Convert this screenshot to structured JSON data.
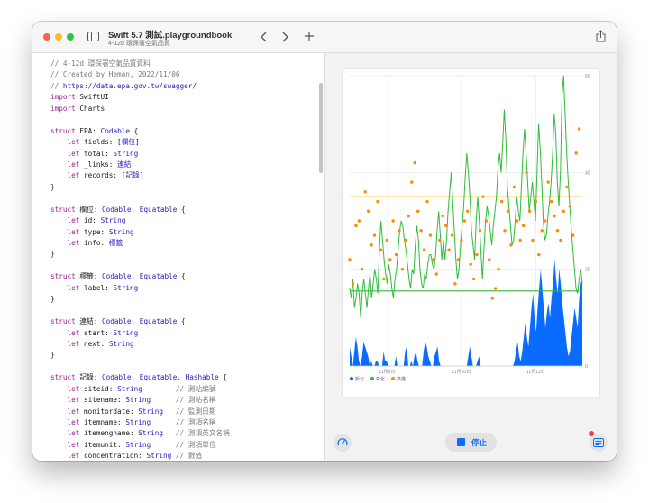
{
  "window": {
    "title": "Swift 5.7 測試.playgroundbook",
    "subtitle": "4-12d 環保署空氣品質"
  },
  "editor": {
    "lines": [
      [
        {
          "t": "// 4-12d 環保署空氣品質資料",
          "c": "comment"
        }
      ],
      [
        {
          "t": "// Created by Heman, 2022/11/06",
          "c": "comment"
        }
      ],
      [
        {
          "t": "// ",
          "c": "comment"
        },
        {
          "t": "https://data.epa.gov.tw/swagger/",
          "c": "link"
        }
      ],
      [
        {
          "t": "import",
          "c": "keyword"
        },
        {
          "t": " SwiftUI",
          "c": "plain"
        }
      ],
      [
        {
          "t": "import",
          "c": "keyword"
        },
        {
          "t": " Charts",
          "c": "plain"
        }
      ],
      [],
      [
        {
          "t": "struct",
          "c": "keyword"
        },
        {
          "t": " EPA: ",
          "c": "plain"
        },
        {
          "t": "Codable",
          "c": "type"
        },
        {
          "t": " {",
          "c": "plain"
        }
      ],
      [
        {
          "t": "    let",
          "c": "keyword"
        },
        {
          "t": " fields: [",
          "c": "plain"
        },
        {
          "t": "欄位",
          "c": "type"
        },
        {
          "t": "]",
          "c": "plain"
        }
      ],
      [
        {
          "t": "    let",
          "c": "keyword"
        },
        {
          "t": " total: ",
          "c": "plain"
        },
        {
          "t": "String",
          "c": "type"
        }
      ],
      [
        {
          "t": "    let",
          "c": "keyword"
        },
        {
          "t": " _links: ",
          "c": "plain"
        },
        {
          "t": "連結",
          "c": "type"
        }
      ],
      [
        {
          "t": "    let",
          "c": "keyword"
        },
        {
          "t": " records: [",
          "c": "plain"
        },
        {
          "t": "記錄",
          "c": "type"
        },
        {
          "t": "]",
          "c": "plain"
        }
      ],
      [
        {
          "t": "}",
          "c": "plain"
        }
      ],
      [],
      [
        {
          "t": "struct",
          "c": "keyword"
        },
        {
          "t": " 欄位: ",
          "c": "plain"
        },
        {
          "t": "Codable",
          "c": "type"
        },
        {
          "t": ", ",
          "c": "plain"
        },
        {
          "t": "Equatable",
          "c": "type"
        },
        {
          "t": " {",
          "c": "plain"
        }
      ],
      [
        {
          "t": "    let",
          "c": "keyword"
        },
        {
          "t": " id: ",
          "c": "plain"
        },
        {
          "t": "String",
          "c": "type"
        }
      ],
      [
        {
          "t": "    let",
          "c": "keyword"
        },
        {
          "t": " type: ",
          "c": "plain"
        },
        {
          "t": "String",
          "c": "type"
        }
      ],
      [
        {
          "t": "    let",
          "c": "keyword"
        },
        {
          "t": " info: ",
          "c": "plain"
        },
        {
          "t": "標籤",
          "c": "type"
        }
      ],
      [
        {
          "t": "}",
          "c": "plain"
        }
      ],
      [],
      [
        {
          "t": "struct",
          "c": "keyword"
        },
        {
          "t": " 標籤: ",
          "c": "plain"
        },
        {
          "t": "Codable",
          "c": "type"
        },
        {
          "t": ", ",
          "c": "plain"
        },
        {
          "t": "Equatable",
          "c": "type"
        },
        {
          "t": " {",
          "c": "plain"
        }
      ],
      [
        {
          "t": "    let",
          "c": "keyword"
        },
        {
          "t": " label: ",
          "c": "plain"
        },
        {
          "t": "String",
          "c": "type"
        }
      ],
      [
        {
          "t": "}",
          "c": "plain"
        }
      ],
      [],
      [
        {
          "t": "struct",
          "c": "keyword"
        },
        {
          "t": " 連結: ",
          "c": "plain"
        },
        {
          "t": "Codable",
          "c": "type"
        },
        {
          "t": ", ",
          "c": "plain"
        },
        {
          "t": "Equatable",
          "c": "type"
        },
        {
          "t": " {",
          "c": "plain"
        }
      ],
      [
        {
          "t": "    let",
          "c": "keyword"
        },
        {
          "t": " start: ",
          "c": "plain"
        },
        {
          "t": "String",
          "c": "type"
        }
      ],
      [
        {
          "t": "    let",
          "c": "keyword"
        },
        {
          "t": " next: ",
          "c": "plain"
        },
        {
          "t": "String",
          "c": "type"
        }
      ],
      [
        {
          "t": "}",
          "c": "plain"
        }
      ],
      [],
      [
        {
          "t": "struct",
          "c": "keyword"
        },
        {
          "t": " 記錄: ",
          "c": "plain"
        },
        {
          "t": "Codable",
          "c": "type"
        },
        {
          "t": ", ",
          "c": "plain"
        },
        {
          "t": "Equatable",
          "c": "type"
        },
        {
          "t": ", ",
          "c": "plain"
        },
        {
          "t": "Hashable",
          "c": "type"
        },
        {
          "t": " {",
          "c": "plain"
        }
      ],
      [
        {
          "t": "    let",
          "c": "keyword"
        },
        {
          "t": " siteid: ",
          "c": "plain"
        },
        {
          "t": "String",
          "c": "type"
        },
        {
          "t": "        // 測站編號",
          "c": "comment"
        }
      ],
      [
        {
          "t": "    let",
          "c": "keyword"
        },
        {
          "t": " sitename: ",
          "c": "plain"
        },
        {
          "t": "String",
          "c": "type"
        },
        {
          "t": "      // 測站名稱",
          "c": "comment"
        }
      ],
      [
        {
          "t": "    let",
          "c": "keyword"
        },
        {
          "t": " monitordate: ",
          "c": "plain"
        },
        {
          "t": "String",
          "c": "type"
        },
        {
          "t": "   // 監測日期",
          "c": "comment"
        }
      ],
      [
        {
          "t": "    let",
          "c": "keyword"
        },
        {
          "t": " itemname: ",
          "c": "plain"
        },
        {
          "t": "String",
          "c": "type"
        },
        {
          "t": "      // 測項名稱",
          "c": "comment"
        }
      ],
      [
        {
          "t": "    let",
          "c": "keyword"
        },
        {
          "t": " itemengname: ",
          "c": "plain"
        },
        {
          "t": "String",
          "c": "type"
        },
        {
          "t": "   // 測項英文名稱",
          "c": "comment"
        }
      ],
      [
        {
          "t": "    let",
          "c": "keyword"
        },
        {
          "t": " itemunit: ",
          "c": "plain"
        },
        {
          "t": "String",
          "c": "type"
        },
        {
          "t": "      // 測項單位",
          "c": "comment"
        }
      ],
      [
        {
          "t": "    let",
          "c": "keyword"
        },
        {
          "t": " concentration: ",
          "c": "plain"
        },
        {
          "t": "String",
          "c": "type"
        },
        {
          "t": " // 數值",
          "c": "comment"
        }
      ]
    ]
  },
  "colors": {
    "comment": "#7b7b7b",
    "keyword": "#9b2393",
    "type": "#2a22b8",
    "link": "#2a22b8",
    "plain": "#1a1a1a",
    "series_blue": "#0a6cff",
    "series_green": "#2ebd39",
    "series_orange": "#ff8a00",
    "rule_yellow": "#f5c518",
    "rule_green": "#2ebd39"
  },
  "icons": {
    "sidebar": "sidebar-icon",
    "back": "chevron-left-icon",
    "forward": "chevron-right-icon",
    "add": "plus-icon",
    "share": "share-icon",
    "meter": "speedometer-icon",
    "console": "console-icon",
    "stop": "stop-icon"
  },
  "controls": {
    "stop_label": "停止"
  },
  "chart_data": {
    "type": "area",
    "y_ticks": [
      "0",
      "20",
      "40",
      "60"
    ],
    "ylim": [
      0,
      60
    ],
    "x_ticks": [
      "11月8日",
      "11月10日",
      "11月12日"
    ],
    "x_tick_positions": [
      24,
      72,
      120
    ],
    "xlim": [
      0,
      150
    ],
    "grid": true,
    "legend_position": "bottom-left",
    "series": [
      {
        "name": "新北",
        "kind": "area",
        "color": "#0a6cff",
        "values": [
          4,
          2,
          0,
          3,
          6,
          4,
          1,
          0,
          2,
          5,
          4,
          3,
          2,
          0,
          1,
          0,
          0,
          1,
          1,
          0,
          0,
          0,
          3,
          1,
          1,
          0,
          0,
          0,
          0,
          0,
          2,
          0,
          0,
          0,
          0,
          0,
          3,
          4,
          0,
          0,
          1,
          0,
          2,
          3,
          1,
          0,
          0,
          0,
          3,
          5,
          4,
          2,
          1,
          0,
          0,
          2,
          3,
          4,
          1,
          0,
          0,
          0,
          0,
          0,
          0,
          0,
          0,
          0,
          0,
          0,
          0,
          0,
          0,
          0,
          0,
          0,
          0,
          2,
          4,
          2,
          0,
          0,
          0,
          1,
          2,
          0,
          0,
          0,
          0,
          0,
          0,
          0,
          0,
          0,
          0,
          0,
          0,
          0,
          0,
          0,
          0,
          0,
          0,
          0,
          0,
          0,
          0,
          1,
          3,
          5,
          2,
          1,
          3,
          6,
          9,
          6,
          4,
          8,
          12,
          15,
          10,
          7,
          12,
          16,
          20,
          16,
          12,
          8,
          11,
          13,
          10,
          14,
          17,
          22,
          18,
          15,
          20,
          17,
          13,
          10,
          7,
          4,
          2,
          3,
          6,
          9,
          12,
          10,
          8,
          14,
          17,
          18
        ]
      },
      {
        "name": "彰化",
        "kind": "line",
        "color": "#2ebd39",
        "values": [
          16,
          14,
          18,
          12,
          14,
          17,
          15,
          10,
          15,
          18,
          15,
          12,
          16,
          19,
          14,
          17,
          20,
          18,
          15,
          24,
          30,
          26,
          22,
          19,
          17,
          21,
          19,
          16,
          14,
          18,
          20,
          24,
          28,
          30,
          29,
          26,
          24,
          21,
          18,
          16,
          20,
          19,
          25,
          29,
          26,
          20,
          17,
          16,
          19,
          18,
          21,
          23,
          23,
          21,
          20,
          23,
          28,
          32,
          27,
          22,
          26,
          22,
          26,
          32,
          36,
          40,
          34,
          28,
          22,
          18,
          20,
          25,
          29,
          33,
          39,
          44,
          40,
          35,
          28,
          25,
          22,
          30,
          35,
          30,
          24,
          18,
          24,
          30,
          33,
          31,
          28,
          25,
          29,
          32,
          35,
          41,
          44,
          40,
          46,
          53,
          47,
          37,
          33,
          29,
          25,
          26,
          30,
          35,
          32,
          30,
          37,
          44,
          49,
          44,
          38,
          32,
          35,
          38,
          34,
          30,
          40,
          50,
          45,
          38,
          30,
          26,
          27,
          31,
          34,
          38,
          44,
          52,
          48,
          38,
          33,
          40,
          56,
          60,
          52,
          44,
          38,
          33,
          28,
          24,
          20,
          16,
          15,
          18,
          20,
          17
        ]
      },
      {
        "name": "高雄",
        "kind": "scatter",
        "color": "#ff8a00",
        "points": [
          [
            0,
            22
          ],
          [
            2,
            17
          ],
          [
            4,
            29
          ],
          [
            6,
            30
          ],
          [
            8,
            20
          ],
          [
            10,
            36
          ],
          [
            12,
            32
          ],
          [
            14,
            25
          ],
          [
            16,
            27
          ],
          [
            18,
            34
          ],
          [
            20,
            24
          ],
          [
            22,
            18
          ],
          [
            24,
            26
          ],
          [
            26,
            22
          ],
          [
            28,
            30
          ],
          [
            30,
            23
          ],
          [
            32,
            28
          ],
          [
            34,
            20
          ],
          [
            36,
            26
          ],
          [
            38,
            31
          ],
          [
            40,
            38
          ],
          [
            42,
            42
          ],
          [
            44,
            32
          ],
          [
            46,
            28
          ],
          [
            48,
            24
          ],
          [
            50,
            34
          ],
          [
            52,
            27
          ],
          [
            54,
            22
          ],
          [
            56,
            19
          ],
          [
            58,
            26
          ],
          [
            60,
            31
          ],
          [
            62,
            29
          ],
          [
            64,
            24
          ],
          [
            66,
            27
          ],
          [
            68,
            17
          ],
          [
            70,
            22
          ],
          [
            72,
            26
          ],
          [
            74,
            30
          ],
          [
            76,
            32
          ],
          [
            78,
            21
          ],
          [
            80,
            18
          ],
          [
            82,
            23
          ],
          [
            84,
            28
          ],
          [
            86,
            35
          ],
          [
            88,
            30
          ],
          [
            90,
            22
          ],
          [
            92,
            14
          ],
          [
            94,
            16
          ],
          [
            96,
            20
          ],
          [
            98,
            34
          ],
          [
            100,
            28
          ],
          [
            102,
            32
          ],
          [
            104,
            25
          ],
          [
            106,
            37
          ],
          [
            108,
            30
          ],
          [
            110,
            26
          ],
          [
            112,
            29
          ],
          [
            114,
            40
          ],
          [
            116,
            32
          ],
          [
            118,
            26
          ],
          [
            120,
            34
          ],
          [
            122,
            23
          ],
          [
            124,
            28
          ],
          [
            126,
            30
          ],
          [
            128,
            38
          ],
          [
            130,
            34
          ],
          [
            132,
            31
          ],
          [
            134,
            28
          ],
          [
            136,
            26
          ],
          [
            138,
            32
          ],
          [
            140,
            37
          ],
          [
            142,
            33
          ],
          [
            144,
            27
          ],
          [
            146,
            44
          ],
          [
            148,
            49
          ]
        ]
      }
    ],
    "rules": [
      {
        "label": "",
        "y": 35,
        "color": "#f5c518"
      },
      {
        "label": "",
        "y": 15.5,
        "color": "#2ebd39"
      }
    ]
  }
}
